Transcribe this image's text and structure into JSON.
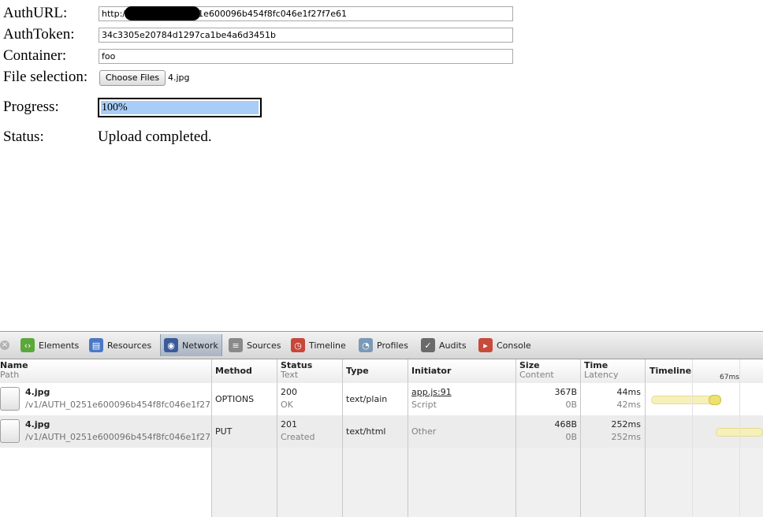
{
  "form": {
    "auth_url_label": "AuthURL:",
    "auth_url_value": "http://            0/v1/AUTH_0251e600096b454f8fc046e1f27f7e61",
    "auth_token_label": "AuthToken:",
    "auth_token_value": "34c3305e20784d1297ca1be4a6d3451b",
    "container_label": "Container:",
    "container_value": "foo",
    "file_label": "File selection:",
    "choose_files_label": "Choose Files",
    "file_name": "4.jpg",
    "progress_label": "Progress:",
    "progress_text": "100%",
    "progress_fraction": 1.0,
    "status_label": "Status:",
    "status_value": "Upload completed."
  },
  "devtools": {
    "tabs": [
      {
        "label": "Elements",
        "icon": "elements-icon",
        "color": "#5aa83a"
      },
      {
        "label": "Resources",
        "icon": "resources-icon",
        "color": "#4a78c8"
      },
      {
        "label": "Network",
        "icon": "network-icon",
        "color": "#3a5a9a",
        "active": true
      },
      {
        "label": "Sources",
        "icon": "sources-icon",
        "color": "#8a8a8a"
      },
      {
        "label": "Timeline",
        "icon": "timeline-icon",
        "color": "#c8463a"
      },
      {
        "label": "Profiles",
        "icon": "profiles-icon",
        "color": "#7a9ab8"
      },
      {
        "label": "Audits",
        "icon": "audits-icon",
        "color": "#6a6a6a"
      },
      {
        "label": "Console",
        "icon": "console-icon",
        "color": "#c84a3a"
      }
    ],
    "columns": {
      "name": "Name",
      "name_sub": "Path",
      "method": "Method",
      "status": "Status",
      "status_sub": "Text",
      "type": "Type",
      "initiator": "Initiator",
      "size": "Size",
      "size_sub": "Content",
      "time": "Time",
      "time_sub": "Latency",
      "timeline": "Timeline",
      "timeline_ms": "67ms"
    },
    "rows": [
      {
        "name": "4.jpg",
        "path": "/v1/AUTH_0251e600096b454f8fc046e1f27",
        "method": "OPTIONS",
        "status": "200",
        "status_text": "OK",
        "type": "text/plain",
        "initiator": "app.js:91",
        "initiator_sub": "Script",
        "size": "367B",
        "content": "0B",
        "time": "44ms",
        "latency": "42ms"
      },
      {
        "name": "4.jpg",
        "path": "/v1/AUTH_0251e600096b454f8fc046e1f27",
        "method": "PUT",
        "status": "201",
        "status_text": "Created",
        "type": "text/html",
        "initiator": "Other",
        "size": "468B",
        "content": "0B",
        "time": "252ms",
        "latency": "252ms"
      }
    ]
  }
}
